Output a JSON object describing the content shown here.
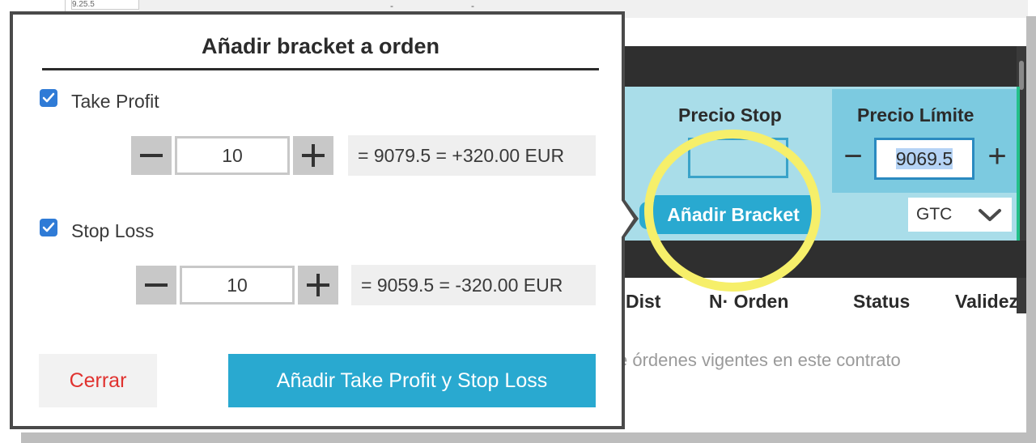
{
  "background": {
    "top_cell_text": "9.25.5",
    "top_strip_marks": [
      "-",
      "-"
    ],
    "order_row": {
      "stop_price_label": "Precio Stop",
      "stop_price_value": "",
      "limit_price_label": "Precio Límite",
      "limit_minus_label": "−",
      "limit_price_value": "9069.5",
      "limit_plus_label": "+",
      "add_bracket_label": "Añadir Bracket",
      "validity_select_value": "GTC"
    },
    "table_headers": [
      "Dist",
      "N· Orden",
      "Status",
      "Validez"
    ],
    "empty_message": "e órdenes vigentes en este contrato"
  },
  "dialog": {
    "title": "Añadir bracket a orden",
    "take_profit": {
      "label": "Take Profit",
      "checked": true,
      "minus_label": "−",
      "value": "10",
      "plus_label": "+",
      "result": "= 9079.5 = +320.00 EUR"
    },
    "stop_loss": {
      "label": "Stop Loss",
      "checked": true,
      "minus_label": "−",
      "value": "10",
      "plus_label": "+",
      "result": "= 9059.5 = -320.00 EUR"
    },
    "close_label": "Cerrar",
    "submit_label": "Añadir Take Profit y Stop Loss"
  },
  "colors": {
    "accent": "#29a9d0",
    "checkbox": "#2f7bd6",
    "close_text": "#e0322f",
    "highlight": "#f6ef6a",
    "row_bg": "#a9dde9",
    "dark_bar": "#2f2f2f"
  },
  "icons": {
    "checkbox": "checkmark-icon",
    "select": "chevron-down-icon",
    "stepper_minus": "minus-icon",
    "stepper_plus": "plus-icon"
  }
}
